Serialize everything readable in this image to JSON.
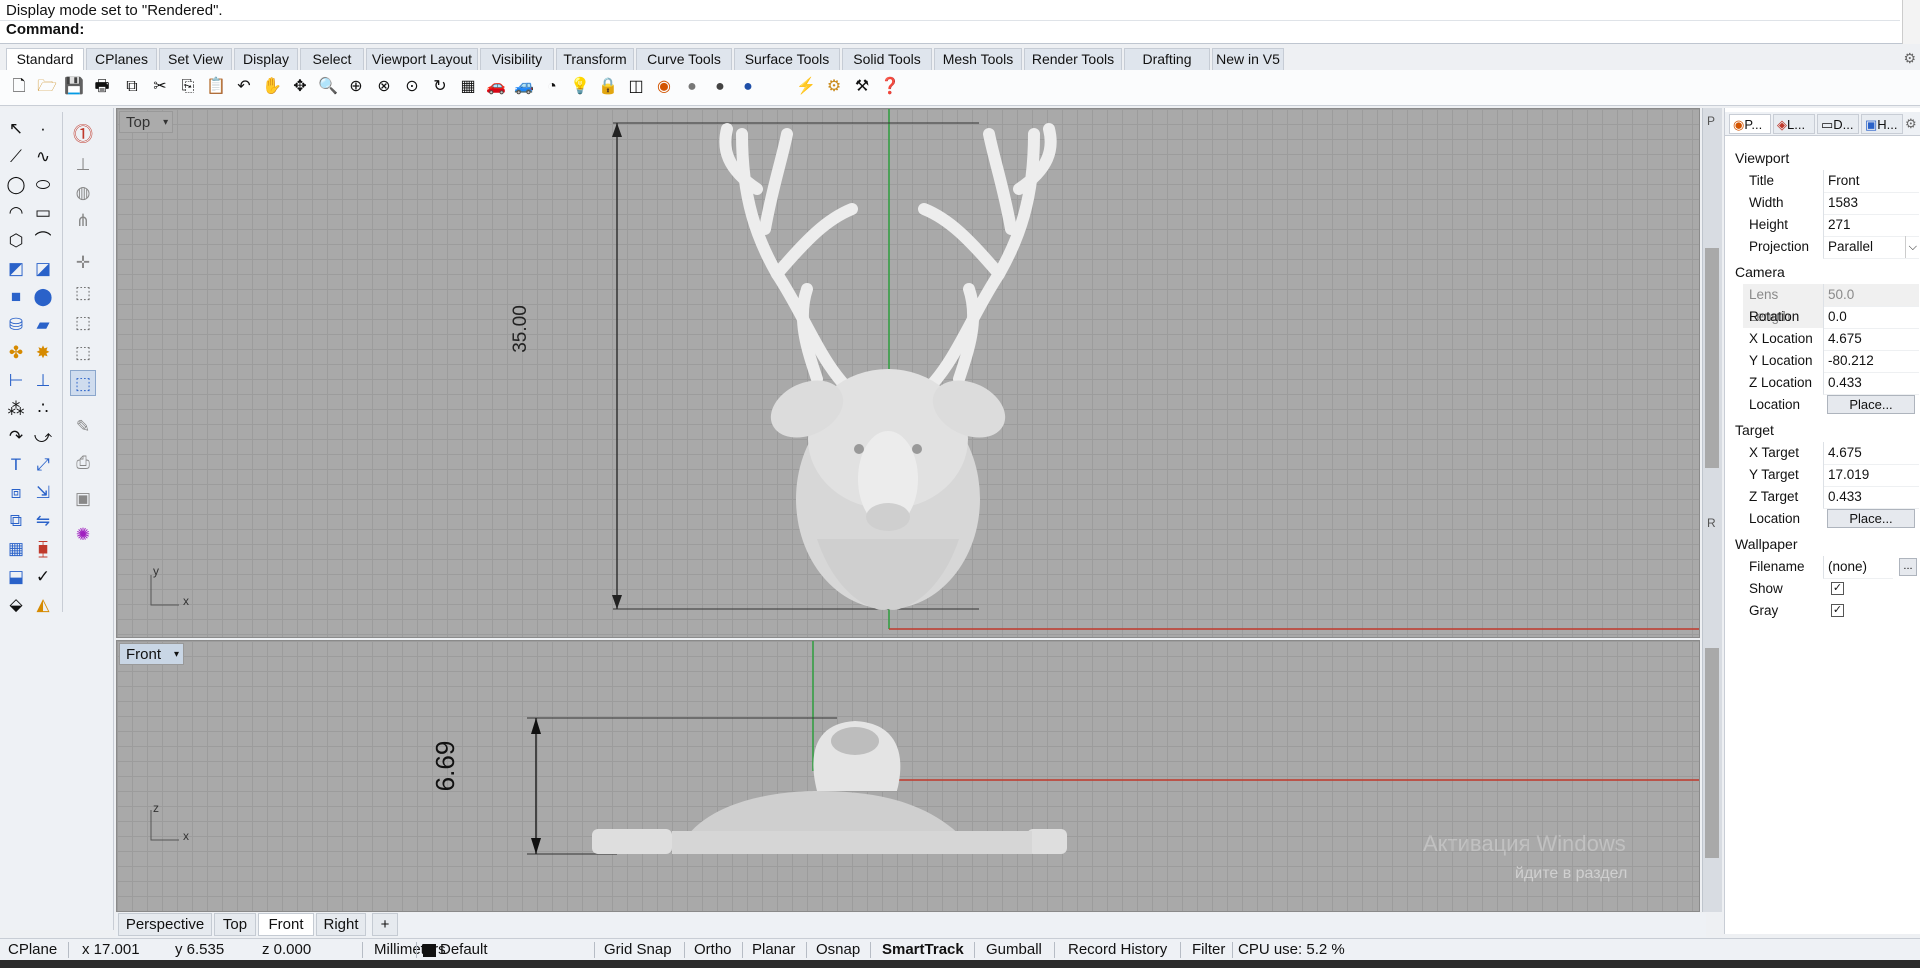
{
  "command": {
    "history": "Display mode set to \"Rendered\".",
    "prompt": "Command:"
  },
  "tabs": [
    "Standard",
    "CPlanes",
    "Set View",
    "Display",
    "Select",
    "Viewport Layout",
    "Visibility",
    "Transform",
    "Curve Tools",
    "Surface Tools",
    "Solid Tools",
    "Mesh Tools",
    "Render Tools",
    "Drafting",
    "New in V5"
  ],
  "toolbar_icons": [
    "new-icon",
    "open-icon",
    "save-icon",
    "print-icon",
    "import-icon",
    "cut-icon",
    "copy-icon",
    "paste-icon",
    "undo-icon",
    "pan-icon",
    "move-icon",
    "zoom-icon",
    "zoom-window-icon",
    "zoom-extents-icon",
    "zoom-selected-icon",
    "rotate-view-icon",
    "grid-icon",
    "car-icon",
    "car-alt-icon",
    "analyze-icon",
    "light-icon",
    "lock-icon",
    "layer-icon",
    "color-wheel-icon",
    "sphere-icon",
    "sphere-dark-icon",
    "sphere-blue-icon",
    "spotlight-icon",
    "settings-icon",
    "options-icon",
    "help-icon"
  ],
  "viewports": {
    "top": {
      "label": "Top",
      "dimension": "35.00",
      "axis_y": "y",
      "axis_x": "x"
    },
    "front": {
      "label": "Front",
      "dimension": "6.69",
      "axis_z": "z",
      "axis_x": "x"
    }
  },
  "viewport_tabs": [
    "Perspective",
    "Top",
    "Front",
    "Right"
  ],
  "viewport_tab_add": "+",
  "panel": {
    "tabs": [
      "P...",
      "L...",
      "D...",
      "H..."
    ],
    "viewport_section": "Viewport",
    "title_k": "Title",
    "title_v": "Front",
    "width_k": "Width",
    "width_v": "1583",
    "height_k": "Height",
    "height_v": "271",
    "projection_k": "Projection",
    "projection_v": "Parallel",
    "camera_section": "Camera",
    "lens_k": "Lens Length",
    "lens_v": "50.0",
    "rotation_k": "Rotation",
    "rotation_v": "0.0",
    "xloc_k": "X Location",
    "xloc_v": "4.675",
    "yloc_k": "Y Location",
    "yloc_v": "-80.212",
    "zloc_k": "Z Location",
    "zloc_v": "0.433",
    "loc_k": "Location",
    "place_btn": "Place...",
    "target_section": "Target",
    "xt_k": "X Target",
    "xt_v": "4.675",
    "yt_k": "Y Target",
    "yt_v": "17.019",
    "zt_k": "Z Target",
    "zt_v": "0.433",
    "tloc_k": "Location",
    "tplace_btn": "Place...",
    "wallpaper_section": "Wallpaper",
    "filename_k": "Filename",
    "filename_v": "(none)",
    "browse_btn": "...",
    "show_k": "Show",
    "show_checked": true,
    "gray_k": "Gray",
    "gray_checked": true
  },
  "status": {
    "cplane": "CPlane",
    "x": "x 17.001",
    "y": "y 6.535",
    "z": "z 0.000",
    "units": "Millimeters",
    "layer": "Default",
    "grid_snap": "Grid Snap",
    "ortho": "Ortho",
    "planar": "Planar",
    "osnap": "Osnap",
    "smarttrack": "SmartTrack",
    "gumball": "Gumball",
    "record_history": "Record History",
    "filter": "Filter",
    "cpu": "CPU use: 5.2 %"
  },
  "watermark": {
    "line1": "Активация Windows",
    "line2": "йдите в раздел"
  },
  "colors": {
    "x_axis": "#c0392b",
    "y_axis": "#2e9e3e",
    "viewport_bg": "#a9a9a9",
    "active_label": "#c9d6e5"
  }
}
